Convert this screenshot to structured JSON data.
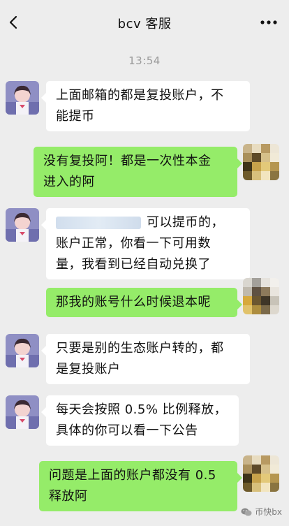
{
  "header": {
    "title": "bcv 客服"
  },
  "timestamp": "13:54",
  "messages": [
    {
      "side": "in",
      "lines": [
        "上面邮箱的都是复投账户，不",
        "能提币"
      ]
    },
    {
      "side": "out",
      "lines": [
        "没有复投阿！都是一次性本金",
        "进入的阿"
      ]
    },
    {
      "side": "in",
      "lines": [
        "可以提币的，",
        "账户正常，你看一下可用数",
        "量，我看到已经自动兑换了"
      ]
    },
    {
      "side": "out",
      "lines": [
        "那我的账号什么时候退本呢"
      ]
    },
    {
      "side": "in",
      "lines": [
        "只要是别的生态账户转的，都",
        "是复投账户"
      ]
    },
    {
      "side": "in",
      "lines": [
        "每天会按照 0.5% 比例释放，",
        "具体的你可以看一下公告"
      ]
    },
    {
      "side": "out",
      "lines": [
        "问题是上面的账户都没有 0.5",
        "释放阿"
      ]
    }
  ],
  "watermark": {
    "text": "币快bx"
  },
  "colors": {
    "bg": "#ededed",
    "incoming": "#ffffff",
    "outgoing": "#95ec69"
  }
}
